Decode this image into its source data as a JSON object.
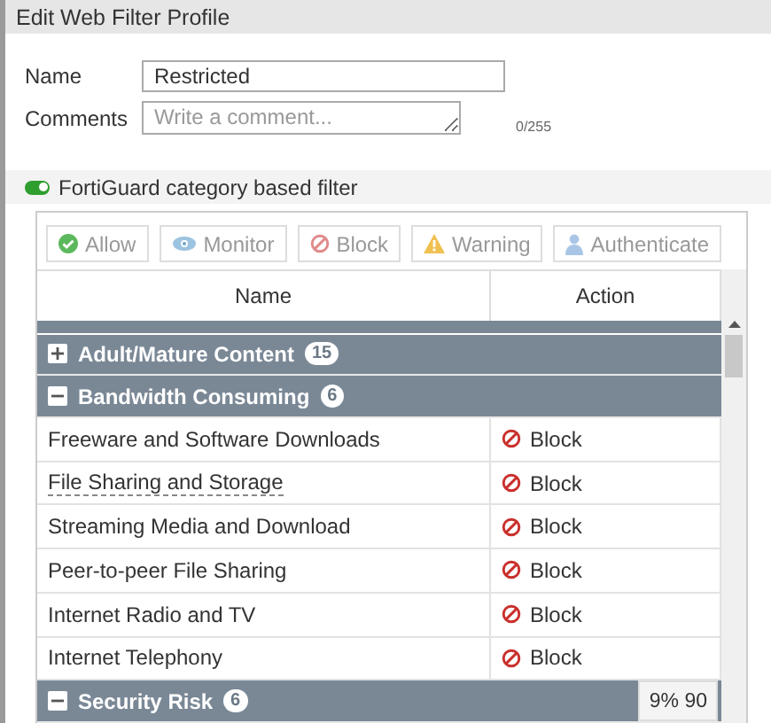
{
  "window": {
    "title": "Edit Web Filter Profile"
  },
  "form": {
    "name": {
      "label": "Name",
      "value": "Restricted"
    },
    "comments": {
      "label": "Comments",
      "placeholder": "Write a comment...",
      "counter": "0/255"
    }
  },
  "filter_toggle": {
    "label": "FortiGuard category based filter",
    "on": true
  },
  "toolbar": [
    {
      "kind": "allow",
      "label": "Allow",
      "disabled": true
    },
    {
      "kind": "monitor",
      "label": "Monitor",
      "disabled": true
    },
    {
      "kind": "block",
      "label": "Block",
      "disabled": true
    },
    {
      "kind": "warning",
      "label": "Warning",
      "disabled": true
    },
    {
      "kind": "authenticate",
      "label": "Authenticate",
      "disabled": true
    }
  ],
  "table": {
    "columns": [
      "Name",
      "Action"
    ],
    "groups": [
      {
        "name": "Adult/Mature Content",
        "count": "15",
        "expanded": false
      },
      {
        "name": "Bandwidth Consuming",
        "count": "6",
        "expanded": true,
        "rows": [
          {
            "name": "Freeware and Software Downloads",
            "hint": false,
            "action": {
              "kind": "block",
              "label": "Block"
            }
          },
          {
            "name": "File Sharing and Storage",
            "hint": true,
            "action": {
              "kind": "block",
              "label": "Block"
            }
          },
          {
            "name": "Streaming Media and Download",
            "hint": false,
            "action": {
              "kind": "block",
              "label": "Block"
            }
          },
          {
            "name": "Peer-to-peer File Sharing",
            "hint": false,
            "action": {
              "kind": "block",
              "label": "Block"
            }
          },
          {
            "name": "Internet Radio and TV",
            "hint": false,
            "action": {
              "kind": "block",
              "label": "Block"
            }
          },
          {
            "name": "Internet Telephony",
            "hint": false,
            "action": {
              "kind": "block",
              "label": "Block"
            }
          }
        ]
      },
      {
        "name": "Security Risk",
        "count": "6",
        "expanded": true
      }
    ],
    "overlay_badge": "9% 90"
  }
}
